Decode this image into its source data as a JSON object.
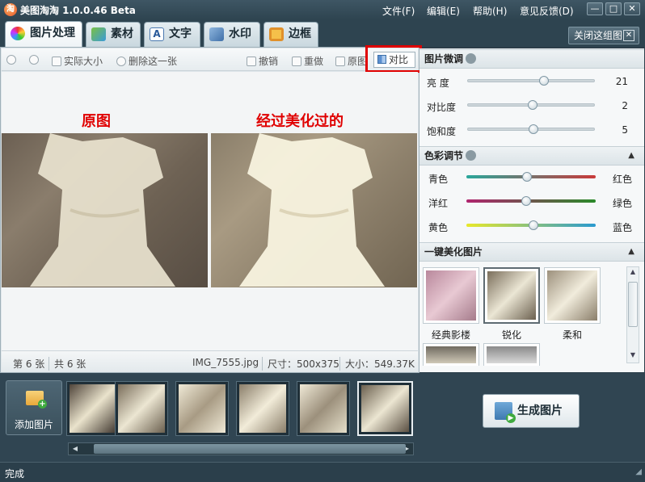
{
  "app": {
    "icon_glyph": "淘",
    "title": "美图淘淘 1.0.0.46 Beta"
  },
  "menu": [
    {
      "label": "文件(F)"
    },
    {
      "label": "编辑(E)"
    },
    {
      "label": "帮助(H)"
    },
    {
      "label": "意见反馈(D)"
    }
  ],
  "window_controls": {
    "minimize": "—",
    "maximize": "□",
    "close": "✕"
  },
  "tabs": [
    {
      "label": "图片处理",
      "icon": "palette-icon",
      "active": true
    },
    {
      "label": "素材",
      "icon": "material-icon",
      "active": false
    },
    {
      "label": "文字",
      "icon": "text-icon",
      "active": false
    },
    {
      "label": "水印",
      "icon": "watermark-icon",
      "active": false
    },
    {
      "label": "边框",
      "icon": "frame-icon",
      "active": false
    }
  ],
  "close_group": {
    "label": "关闭这组图",
    "x": "✕"
  },
  "toolbar": {
    "actual_size": "实际大小",
    "delete": "删除这一张",
    "undo": "撤销",
    "redo": "重做",
    "original": "原图",
    "compare": "对比"
  },
  "canvas": {
    "caption_original": "原图",
    "caption_enhanced": "经过美化过的"
  },
  "status": {
    "index": "第 6 张",
    "total": "共 6 张",
    "filename": "IMG_7555.jpg",
    "dimensions": "尺寸：500x375",
    "filesize": "大小：549.37K"
  },
  "adjust": {
    "title": "图片微调",
    "sliders": [
      {
        "label": "亮  度",
        "value": "21",
        "fraction": 0.6
      },
      {
        "label": "对比度",
        "value": "2",
        "fraction": 0.51
      },
      {
        "label": "饱和度",
        "value": "5",
        "fraction": 0.52
      }
    ]
  },
  "color": {
    "title": "色彩调节",
    "sliders": [
      {
        "left": "青色",
        "right": "红色",
        "fraction": 0.47
      },
      {
        "left": "洋红",
        "right": "绿色",
        "fraction": 0.46
      },
      {
        "left": "黄色",
        "right": "蓝色",
        "fraction": 0.52
      }
    ]
  },
  "presets": {
    "title": "一键美化图片",
    "items": [
      {
        "label": "经典影楼",
        "selected": false
      },
      {
        "label": "锐化",
        "selected": true
      },
      {
        "label": "柔和",
        "selected": false
      }
    ]
  },
  "bottom": {
    "add_label": "添加图片",
    "generate_label": "生成图片"
  },
  "footer": {
    "status": "完成"
  },
  "colors": {
    "accent_red": "#e00000",
    "frame_dark": "#2c3e4a"
  }
}
